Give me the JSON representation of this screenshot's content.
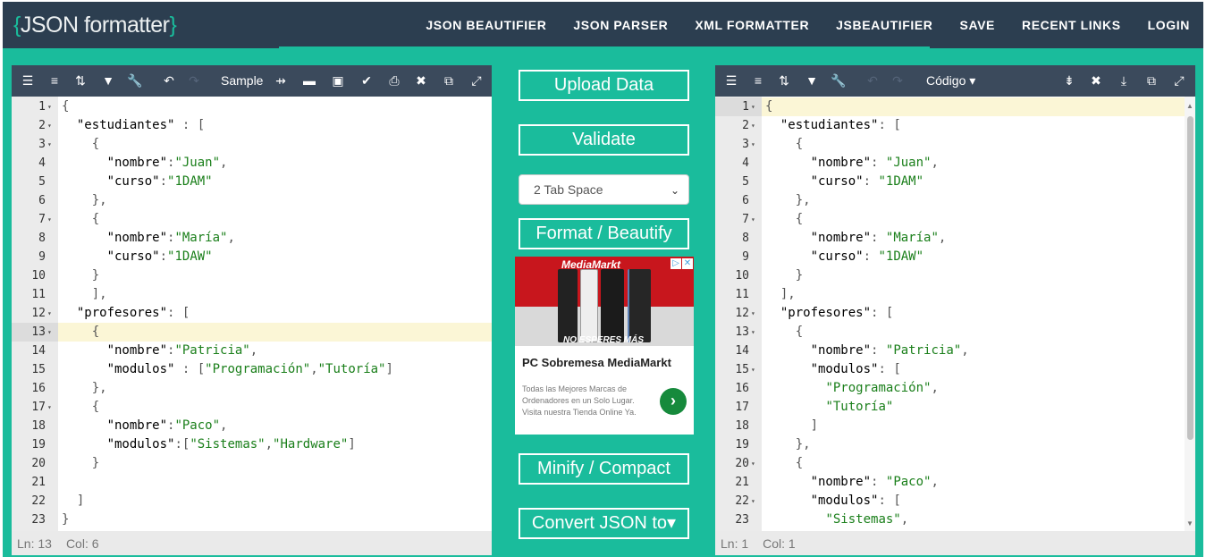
{
  "brand": {
    "open": "{",
    "name": "JSON formatter",
    "close": "}"
  },
  "nav": {
    "links": [
      "JSON BEAUTIFIER",
      "JSON PARSER",
      "XML FORMATTER",
      "JSBEAUTIFIER",
      "SAVE",
      "RECENT LINKS",
      "LOGIN"
    ]
  },
  "left_editor": {
    "toolbar": {
      "sample_label": "Sample"
    },
    "status": {
      "ln": "Ln: 13",
      "col": "Col: 6"
    },
    "lines": [
      {
        "n": "1",
        "fold": true,
        "t": "{"
      },
      {
        "n": "2",
        "fold": true,
        "t": "  \"estudiantes\" : ["
      },
      {
        "n": "3",
        "fold": true,
        "t": "    {"
      },
      {
        "n": "4",
        "fold": false,
        "t": "      \"nombre\":\"Juan\","
      },
      {
        "n": "5",
        "fold": false,
        "t": "      \"curso\":\"1DAM\""
      },
      {
        "n": "6",
        "fold": false,
        "t": "    },"
      },
      {
        "n": "7",
        "fold": true,
        "t": "    {"
      },
      {
        "n": "8",
        "fold": false,
        "t": "      \"nombre\":\"María\","
      },
      {
        "n": "9",
        "fold": false,
        "t": "      \"curso\":\"1DAW\""
      },
      {
        "n": "10",
        "fold": false,
        "t": "    }"
      },
      {
        "n": "11",
        "fold": false,
        "t": "    ],"
      },
      {
        "n": "12",
        "fold": true,
        "t": "  \"profesores\": ["
      },
      {
        "n": "13",
        "fold": true,
        "t": "    {"
      },
      {
        "n": "14",
        "fold": false,
        "t": "      \"nombre\":\"Patricia\","
      },
      {
        "n": "15",
        "fold": false,
        "t": "      \"modulos\" : [\"Programación\",\"Tutoría\"]"
      },
      {
        "n": "16",
        "fold": false,
        "t": "    },"
      },
      {
        "n": "17",
        "fold": true,
        "t": "    {"
      },
      {
        "n": "18",
        "fold": false,
        "t": "      \"nombre\":\"Paco\","
      },
      {
        "n": "19",
        "fold": false,
        "t": "      \"modulos\":[\"Sistemas\",\"Hardware\"]"
      },
      {
        "n": "20",
        "fold": false,
        "t": "    }"
      },
      {
        "n": "21",
        "fold": false,
        "t": ""
      },
      {
        "n": "22",
        "fold": false,
        "t": "  ]"
      },
      {
        "n": "23",
        "fold": false,
        "t": "}"
      }
    ],
    "active_line": 13
  },
  "right_editor": {
    "toolbar": {
      "mode_label": "Código ▾"
    },
    "status": {
      "ln": "Ln: 1",
      "col": "Col: 1"
    },
    "lines": [
      {
        "n": "1",
        "fold": true,
        "t": "{"
      },
      {
        "n": "2",
        "fold": true,
        "t": "  \"estudiantes\": ["
      },
      {
        "n": "3",
        "fold": true,
        "t": "    {"
      },
      {
        "n": "4",
        "fold": false,
        "t": "      \"nombre\": \"Juan\","
      },
      {
        "n": "5",
        "fold": false,
        "t": "      \"curso\": \"1DAM\""
      },
      {
        "n": "6",
        "fold": false,
        "t": "    },"
      },
      {
        "n": "7",
        "fold": true,
        "t": "    {"
      },
      {
        "n": "8",
        "fold": false,
        "t": "      \"nombre\": \"María\","
      },
      {
        "n": "9",
        "fold": false,
        "t": "      \"curso\": \"1DAW\""
      },
      {
        "n": "10",
        "fold": false,
        "t": "    }"
      },
      {
        "n": "11",
        "fold": false,
        "t": "  ],"
      },
      {
        "n": "12",
        "fold": true,
        "t": "  \"profesores\": ["
      },
      {
        "n": "13",
        "fold": true,
        "t": "    {"
      },
      {
        "n": "14",
        "fold": false,
        "t": "      \"nombre\": \"Patricia\","
      },
      {
        "n": "15",
        "fold": true,
        "t": "      \"modulos\": ["
      },
      {
        "n": "16",
        "fold": false,
        "t": "        \"Programación\","
      },
      {
        "n": "17",
        "fold": false,
        "t": "        \"Tutoría\""
      },
      {
        "n": "18",
        "fold": false,
        "t": "      ]"
      },
      {
        "n": "19",
        "fold": false,
        "t": "    },"
      },
      {
        "n": "20",
        "fold": true,
        "t": "    {"
      },
      {
        "n": "21",
        "fold": false,
        "t": "      \"nombre\": \"Paco\","
      },
      {
        "n": "22",
        "fold": true,
        "t": "      \"modulos\": ["
      },
      {
        "n": "23",
        "fold": false,
        "t": "        \"Sistemas\","
      }
    ],
    "active_line": 1
  },
  "middle": {
    "upload_label": "Upload Data",
    "validate_label": "Validate",
    "tab_select": {
      "selected": "2 Tab Space"
    },
    "format_label": "Format / Beautify",
    "minify_label": "Minify / Compact",
    "convert_label": "Convert JSON to▾"
  },
  "ad": {
    "logo": "MediaMarkt",
    "slogan": "NO ESPERES MÁS",
    "title": "PC Sobremesa MediaMarkt",
    "description": "Todas las Mejores Marcas de Ordenadores en un Solo Lugar. Visita nuestra Tienda Online Ya.",
    "colors": {
      "brand_red": "#c8161d",
      "go_green": "#168a3c"
    }
  },
  "colors": {
    "accent": "#1abc9c",
    "navbar": "#2c3e50",
    "toolbar": "#3b4a5c",
    "string": "#1a7f1a"
  },
  "icons": {
    "left_toolbar": [
      "format-icon",
      "compact-icon",
      "sort-icon",
      "filter-icon",
      "repair-icon",
      "undo-icon",
      "redo-icon",
      "usb-icon",
      "open-folder-icon",
      "save-icon",
      "check-icon",
      "print-icon",
      "clear-icon",
      "copy-icon",
      "fullscreen-icon"
    ],
    "right_toolbar": [
      "format-icon",
      "compact-icon",
      "sort-icon",
      "filter-icon",
      "repair-icon",
      "undo-icon",
      "redo-icon",
      "arrow-icon",
      "clear-icon",
      "download-icon",
      "copy-icon",
      "fullscreen-icon"
    ]
  }
}
